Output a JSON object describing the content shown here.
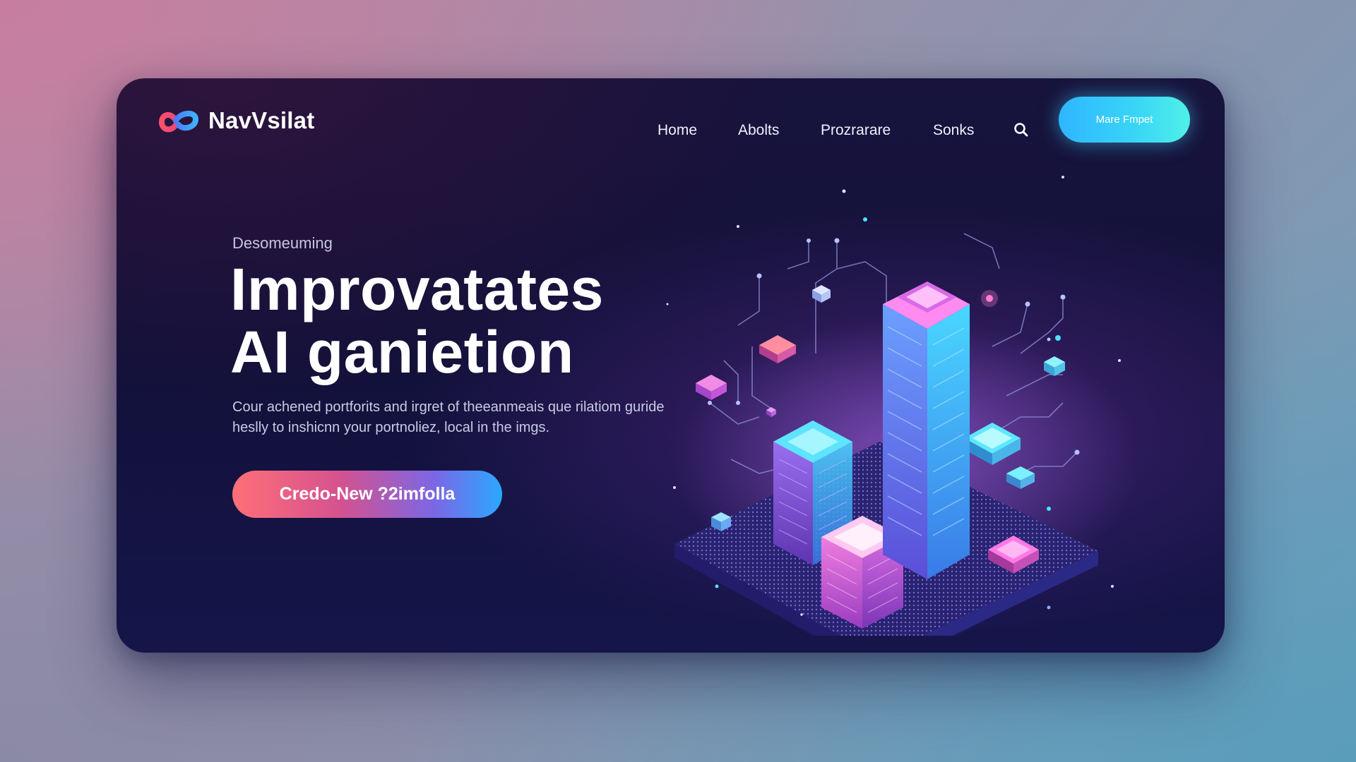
{
  "brand": {
    "name": "NavVsilat",
    "colors": {
      "accent_cyan": "#39d6f6",
      "accent_pink": "#ff6f77",
      "accent_blue": "#2aa8ff",
      "card_bg": "#15133f"
    }
  },
  "nav": {
    "links": [
      {
        "label": "Home"
      },
      {
        "label": "Abolts"
      },
      {
        "label": "Prozrarare"
      },
      {
        "label": "Sonks"
      }
    ],
    "search_icon": "search-icon",
    "cta_label": "Mare Fmpet"
  },
  "hero": {
    "eyebrow": "Desomeuming",
    "headline_line1": "Improvatates",
    "headline_line2": "AI ganietion",
    "description_line1": "Cour achened portforits and irgret of theeanmeais que rilatiom guride",
    "description_line2": "heslly to inshicnn your portnoliez, local in the imgs.",
    "cta_label": "Credo-New ?2imfolla"
  },
  "illustration": {
    "icon": "isometric-data-towers-illustration"
  }
}
